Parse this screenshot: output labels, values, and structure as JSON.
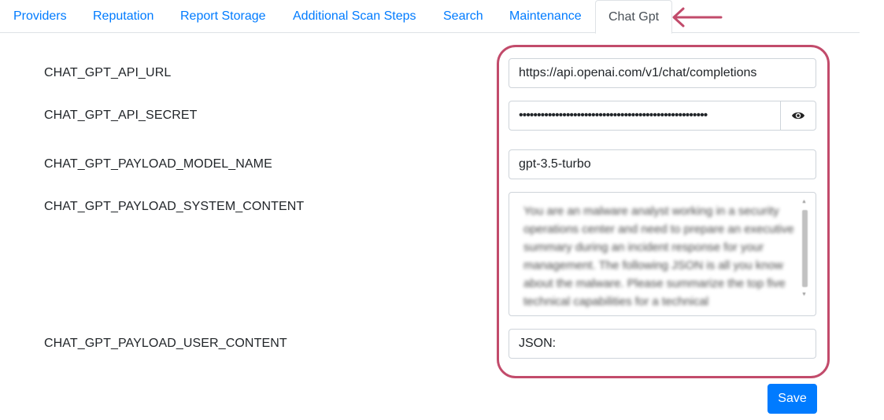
{
  "tabs": [
    {
      "label": "Providers",
      "active": false
    },
    {
      "label": "Reputation",
      "active": false
    },
    {
      "label": "Report Storage",
      "active": false
    },
    {
      "label": "Additional Scan Steps",
      "active": false
    },
    {
      "label": "Search",
      "active": false
    },
    {
      "label": "Maintenance",
      "active": false
    },
    {
      "label": "Chat Gpt",
      "active": true
    }
  ],
  "fields": {
    "api_url": {
      "label": "CHAT_GPT_API_URL",
      "value": "https://api.openai.com/v1/chat/completions"
    },
    "api_secret": {
      "label": "CHAT_GPT_API_SECRET",
      "value": "••••••••••••••••••••••••••••••••••••••••••••••••••••",
      "reveal_icon": "eye-icon"
    },
    "model_name": {
      "label": "CHAT_GPT_PAYLOAD_MODEL_NAME",
      "value": "gpt-3.5-turbo"
    },
    "system_content": {
      "label": "CHAT_GPT_PAYLOAD_SYSTEM_CONTENT",
      "value": "You are an malware analyst working in a security operations center and need to prepare an executive summary during an incident response for your management. The following JSON is all you know about the malware. Please summarize the top five technical capabilities for a technical"
    },
    "user_content": {
      "label": "CHAT_GPT_PAYLOAD_USER_CONTENT",
      "value": "JSON:"
    }
  },
  "actions": {
    "save_label": "Save"
  },
  "colors": {
    "accent": "#007bff",
    "annotation": "#c24b6b",
    "border": "#ced4da",
    "text": "#212529"
  }
}
